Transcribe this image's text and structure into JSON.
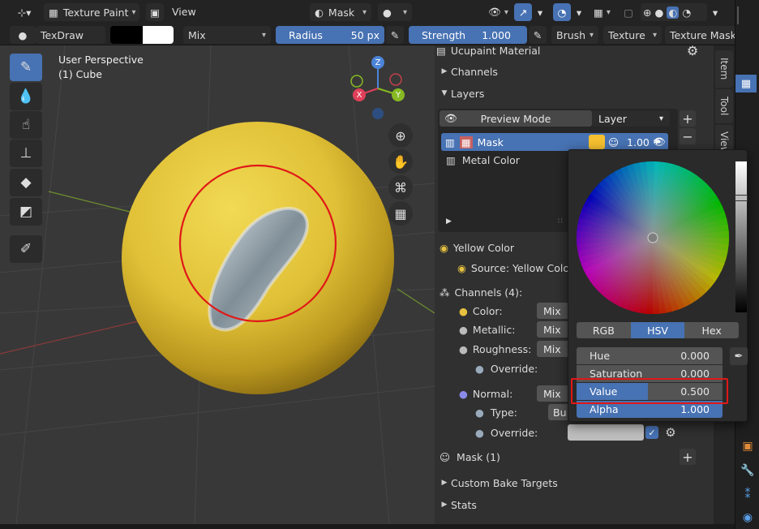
{
  "header": {
    "mode": "Texture Paint",
    "view": "View",
    "mask": "Mask"
  },
  "toolbar": {
    "brush": "TexDraw",
    "blend": "Mix",
    "radius_label": "Radius",
    "radius_value": "50 px",
    "strength_label": "Strength",
    "strength_value": "1.000",
    "brush_menu": "Brush",
    "texture_menu": "Texture",
    "texture_mask_menu": "Texture Mask"
  },
  "viewport": {
    "perspective": "User Perspective",
    "object": "(1) Cube",
    "gizmo": {
      "z": "Z",
      "x": "X",
      "y": "Y"
    }
  },
  "panel": {
    "material": "Ucupaint Material",
    "channels_section": "Channels",
    "layers_section": "Layers",
    "preview_mode": "Preview Mode",
    "layer_select": "Layer",
    "layers": [
      {
        "name": "Mask",
        "value": "1.00"
      },
      {
        "name": "Metal Color"
      }
    ],
    "yellow_color": "Yellow Color",
    "source": "Source: Yellow Color",
    "channels_count": "Channels (4):",
    "channel_rows": [
      {
        "label": "Color:",
        "value": "Mix"
      },
      {
        "label": "Metallic:",
        "value": "Mix"
      },
      {
        "label": "Roughness:",
        "value": "Mix"
      },
      {
        "label": "Override:",
        "value": ""
      },
      {
        "label": "Normal:",
        "value": "Mix"
      },
      {
        "label": "Type:",
        "value": "Bu"
      },
      {
        "label": "Override:",
        "value": ""
      }
    ],
    "mask_group": "Mask (1)",
    "custom_bake": "Custom Bake Targets",
    "stats": "Stats"
  },
  "side_tabs": [
    "Item",
    "Tool",
    "View"
  ],
  "color_picker": {
    "tabs": [
      "RGB",
      "HSV",
      "Hex"
    ],
    "active_tab": "HSV",
    "fields": [
      {
        "label": "Hue",
        "value": "0.000"
      },
      {
        "label": "Saturation",
        "value": "0.000"
      },
      {
        "label": "Value",
        "value": "0.500"
      },
      {
        "label": "Alpha",
        "value": "1.000"
      }
    ]
  },
  "colors": {
    "accent": "#4772b3",
    "sphere": "#e2c33c",
    "brush_ring": "#e01818",
    "highlight_box": "#e01818",
    "swatch": "#f5c030"
  }
}
